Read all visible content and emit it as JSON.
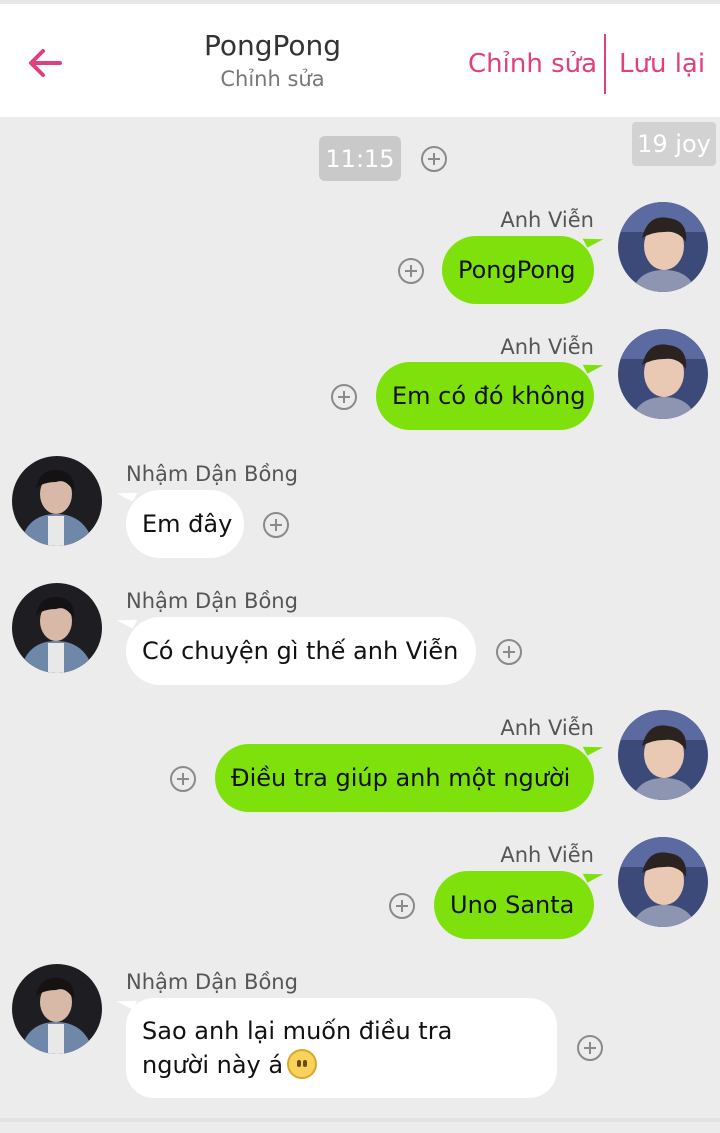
{
  "header": {
    "title": "PongPong",
    "subtitle": "Chỉnh sửa",
    "edit_label": "Chỉnh sửa",
    "save_label": "Lưu lại",
    "accent_color": "#e0407e"
  },
  "watermark": "19 joy",
  "time_label": "11:15",
  "messages": [
    {
      "sender": "Anh Viễn",
      "text": "PongPong",
      "side": "right"
    },
    {
      "sender": "Anh Viễn",
      "text": "Em có đó không",
      "side": "right"
    },
    {
      "sender": "Nhậm Dận Bồng",
      "text": "Em đây",
      "side": "left"
    },
    {
      "sender": "Nhậm Dận Bồng",
      "text": "Có chuyện gì thế anh Viễn",
      "side": "left"
    },
    {
      "sender": "Anh Viễn",
      "text": "Điều tra giúp anh một người",
      "side": "right"
    },
    {
      "sender": "Anh Viễn",
      "text": "Uno Santa",
      "side": "right"
    },
    {
      "sender": "Nhậm Dận Bồng",
      "text": "Sao anh lại muốn điều tra người này á",
      "side": "left"
    }
  ],
  "colors": {
    "outgoing_bubble": "#7ee10b",
    "incoming_bubble": "#ffffff",
    "background": "#ececec"
  },
  "icons": {
    "back": "arrow-left-icon",
    "add": "plus-circle-icon",
    "emoji": "hushed-face-emoji"
  }
}
